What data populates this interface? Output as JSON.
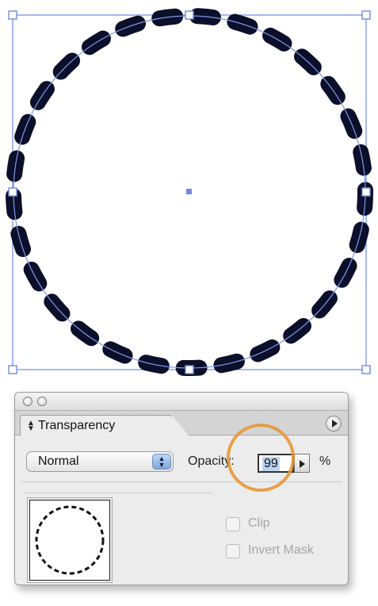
{
  "canvas": {
    "shape": "dashed-circle",
    "stroke_color": "#0b0f2a",
    "selection_color": "#6f8bdf"
  },
  "panel": {
    "tab_label": "Transparency",
    "tab_icon": "stepper-arrows-icon",
    "panel_menu_icon": "panel-menu-arrow-icon",
    "blend_mode": "Normal",
    "opacity_label": "Opacity:",
    "opacity_value": "99",
    "percent_sign": "%",
    "clip_label": "Clip",
    "invert_mask_label": "Invert Mask",
    "highlight_color": "#e89636"
  }
}
